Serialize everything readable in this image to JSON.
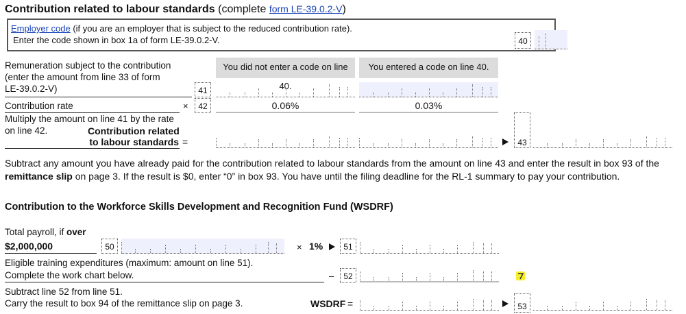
{
  "section1": {
    "title_bold": "Contribution related to labour standards",
    "title_rest": " (complete ",
    "title_link": "form LE-39.0.2-V",
    "title_close": ")",
    "employer_box": {
      "link": "Employer code",
      "line1_rest": " (if you are an employer that is subject to the reduced contribution rate).",
      "line2": "Enter the code shown in box 1a of form LE-39.0.2-V.",
      "box": "40"
    },
    "col_header_no_code": "You did not enter a code on line 40.",
    "col_header_code": "You entered a code on line 40.",
    "line41": {
      "l1": "Remuneration subject to the contribution",
      "l2": "(enter the amount from line 33 of form",
      "l3": "LE-39.0.2-V)",
      "box": "41"
    },
    "line42": {
      "label": "Contribution rate",
      "op": "×",
      "box": "42",
      "rate_no_code": "0.06%",
      "rate_code": "0.03%"
    },
    "line43": {
      "l1": "Multiply the amount on line 41 by the rate",
      "l2": "on line 42.",
      "bold1": "Contribution related",
      "bold2": "to labour standards",
      "eq": "=",
      "box": "43"
    },
    "note_a": "Subtract any amount you have already paid for the contribution related to labour standards from the amount on line 43 and enter the result in box 93 of the ",
    "note_bold": "remittance slip",
    "note_b": " on page 3. If the result is $0, enter “0” in box 93. You have until the filing deadline for the RL-1 summary to pay your contribution."
  },
  "section2": {
    "title": "Contribution to the Workforce Skills Development and Recognition Fund (WSDRF)",
    "line50": {
      "l1": "Total payroll, if ",
      "l1_bold": "over",
      "l2": "$2,000,000",
      "box": "50"
    },
    "line51": {
      "op": "×",
      "pct": "1%",
      "box": "51"
    },
    "line52": {
      "l1": "Eligible training expenditures (maximum: amount on line 51).",
      "l2": "Complete the work chart below.",
      "op": "–",
      "box": "52"
    },
    "line53": {
      "l1": "Subtract line 52 from line 51.",
      "l2": "Carry the result to box 94 of the remittance slip on page 3.",
      "label": "WSDRF",
      "eq": "=",
      "box": "53"
    }
  },
  "colors": {
    "link": "#1a44b8",
    "shaded_field": "#eef0fd",
    "header_grey": "#dcdcdc",
    "marker": "#f5ee2a"
  }
}
